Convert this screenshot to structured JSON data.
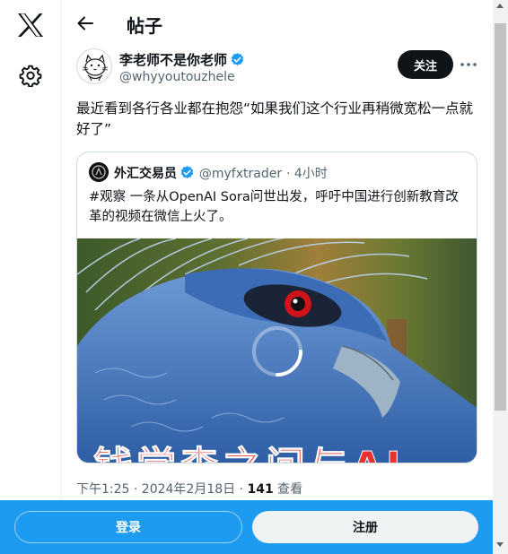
{
  "header": {
    "title": "帖子"
  },
  "author": {
    "name": "李老师不是你老师",
    "handle": "@whyyoutouzhele",
    "follow_label": "关注"
  },
  "tweet": {
    "text": "最近看到各行各业都在抱怨“如果我们这个行业再稍微宽松一点就好了”"
  },
  "quote": {
    "name": "外汇交易员",
    "handle": "@myfxtrader",
    "time": "· 4小时",
    "text": "#观察 一条从OpenAI Sora问世出发，呼吁中国进行创新教育改革的视频在微信上火了。",
    "media_caption": "钱学森之问与AI"
  },
  "meta": {
    "time": "下午1:25 · 2024年2月18日 · ",
    "views": "141",
    "views_label": " 查看"
  },
  "bottom": {
    "login_label": "登录",
    "signup_label": "注册"
  },
  "colors": {
    "accent": "#1d9bf0",
    "verified": "#1d9bf0",
    "text": "#0f1419",
    "muted": "#536471"
  },
  "icons": [
    "x-logo-icon",
    "settings-icon",
    "back-arrow-icon",
    "verified-icon",
    "more-icon"
  ]
}
